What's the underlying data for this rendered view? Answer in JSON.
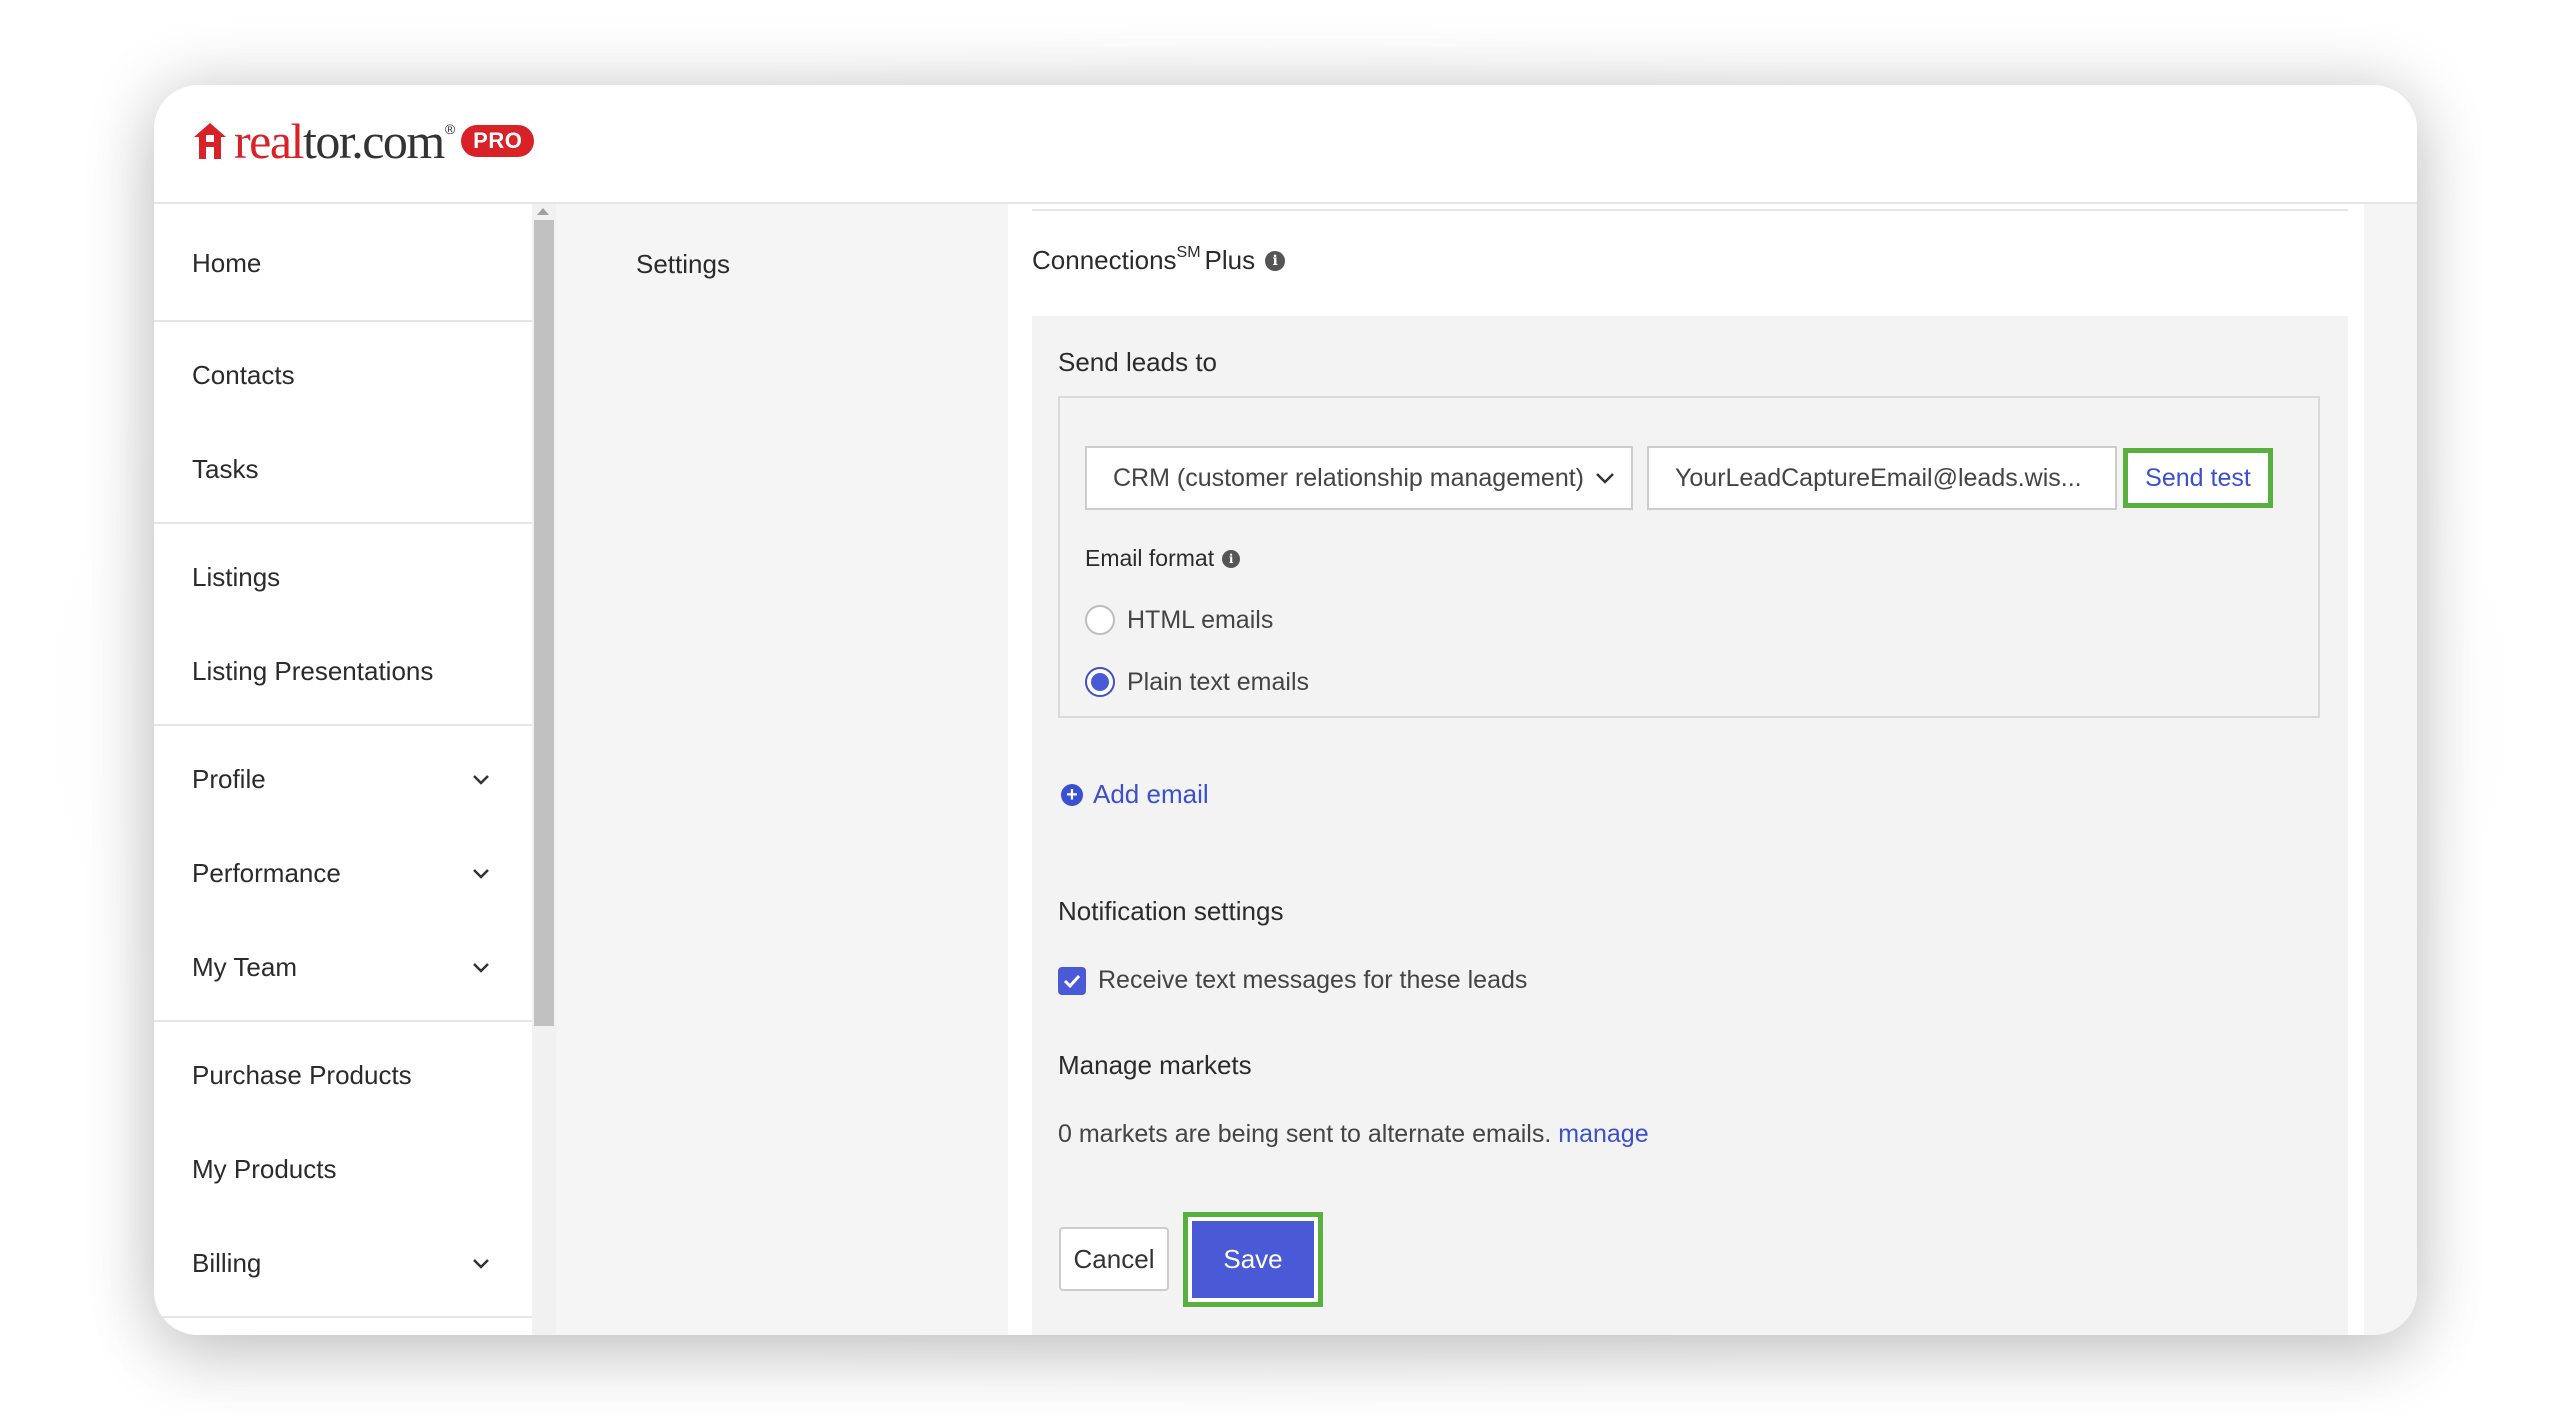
{
  "brand": {
    "logo_text_red": "real",
    "logo_text_dark": "tor.com",
    "logo_reg": "®",
    "badge": "PRO",
    "accent_color": "#d92228"
  },
  "sidebar": {
    "groups": [
      [
        {
          "label": "Home",
          "has_chevron": false
        }
      ],
      [
        {
          "label": "Contacts",
          "has_chevron": false
        },
        {
          "label": "Tasks",
          "has_chevron": false
        }
      ],
      [
        {
          "label": "Listings",
          "has_chevron": false
        },
        {
          "label": "Listing Presentations",
          "has_chevron": false
        }
      ],
      [
        {
          "label": "Profile",
          "has_chevron": true
        },
        {
          "label": "Performance",
          "has_chevron": true
        },
        {
          "label": "My Team",
          "has_chevron": true
        }
      ],
      [
        {
          "label": "Purchase Products",
          "has_chevron": false
        },
        {
          "label": "My Products",
          "has_chevron": false
        },
        {
          "label": "Billing",
          "has_chevron": true
        }
      ]
    ]
  },
  "main": {
    "settings_label": "Settings",
    "connections_title": "Connections",
    "connections_sup": "SM",
    "connections_suffix": "Plus",
    "send_leads_label": "Send leads to",
    "destination_select": "CRM (customer relationship management)",
    "email_value": "YourLeadCaptureEmail@leads.wis...",
    "send_test_label": "Send test",
    "email_format_label": "Email format",
    "radio_html": "HTML emails",
    "radio_plain": "Plain text emails",
    "selected_format": "plain",
    "add_email_label": "Add email",
    "notification_label": "Notification settings",
    "sms_checkbox_label": "Receive text messages for these leads",
    "sms_checked": true,
    "manage_markets_label": "Manage markets",
    "markets_text": "0 markets are being sent to alternate emails.",
    "markets_link": "manage",
    "cancel_label": "Cancel",
    "save_label": "Save",
    "highlight_color": "#58b03f",
    "primary_color": "#4a5ad6",
    "link_color": "#3b4fd1"
  }
}
